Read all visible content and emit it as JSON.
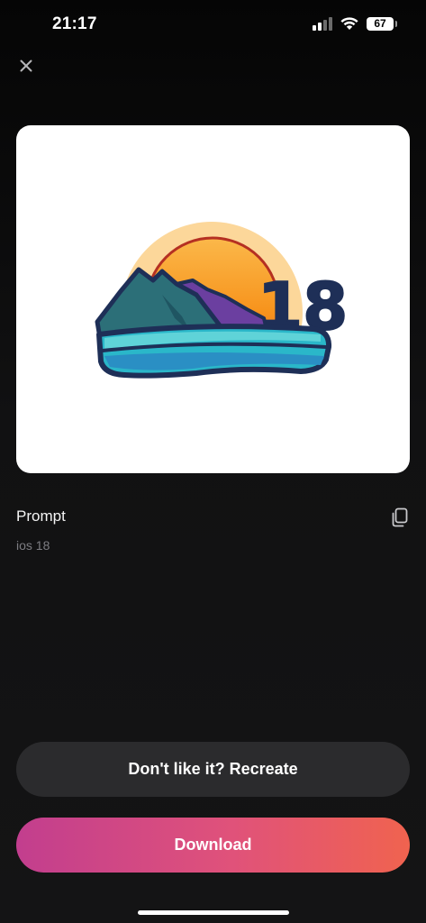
{
  "status_bar": {
    "time": "21:17",
    "battery_level": "67",
    "icons": [
      "signal-icon",
      "wifi-icon",
      "battery-icon"
    ]
  },
  "header": {
    "close_icon": "close-icon"
  },
  "image": {
    "caption_text": "18",
    "colors": {
      "sun_outer": "#fcd79a",
      "sun_inner": "#f7941d",
      "navy": "#1e2f57",
      "mountain": "#2c6f78",
      "water": "#2ab7c9"
    }
  },
  "prompt": {
    "title": "Prompt",
    "text": "ios 18",
    "copy_icon": "copy-icon"
  },
  "actions": {
    "recreate_label": "Don't like it? Recreate",
    "download_label": "Download"
  },
  "colors": {
    "background": "#0b0b0c",
    "recreate_button": "#2b2b2d",
    "download_gradient_start": "#c23e8e",
    "download_gradient_end": "#f0634f"
  }
}
